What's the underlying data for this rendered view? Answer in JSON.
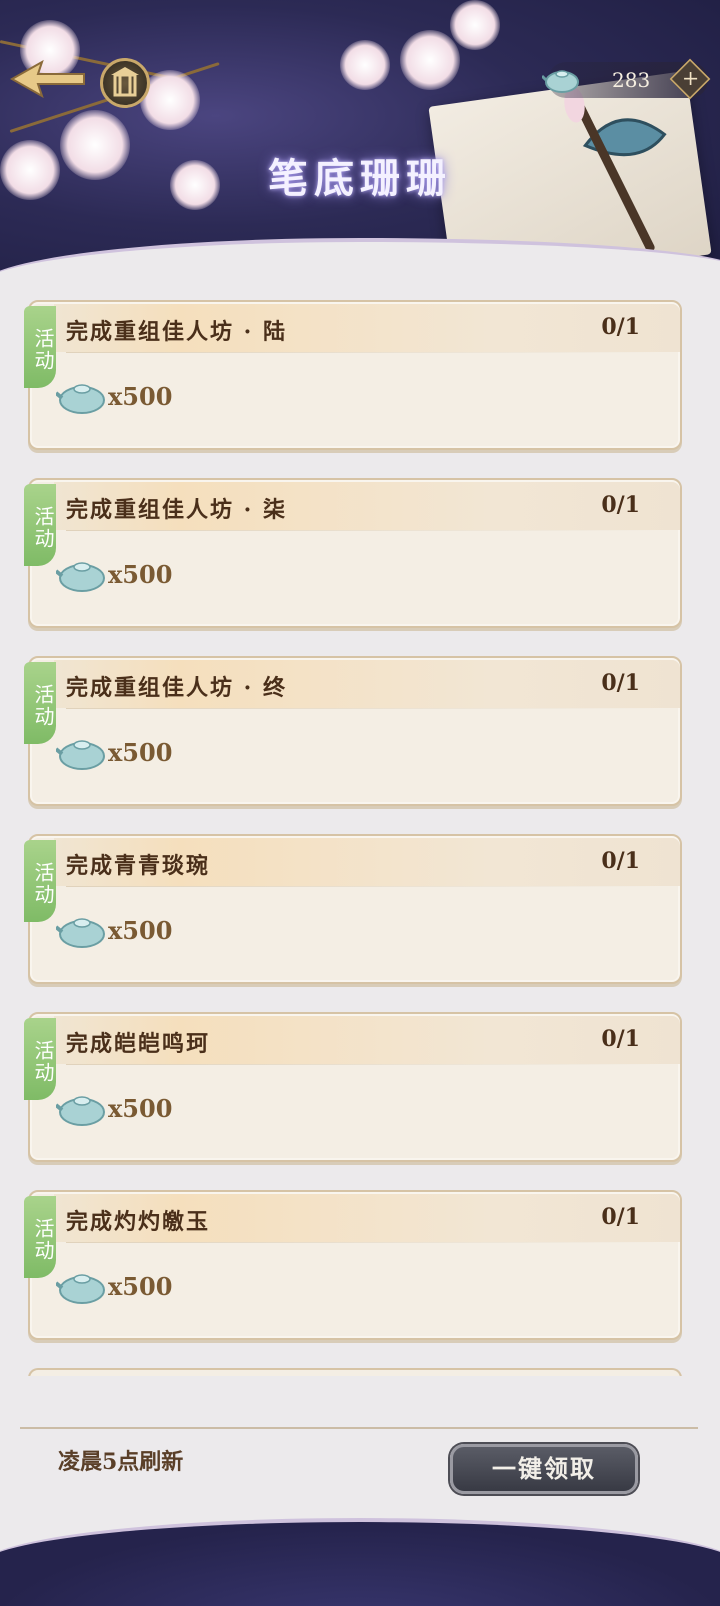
{
  "header": {
    "title": "笔底珊珊",
    "currency": {
      "icon": "jade-teapot-icon",
      "value": "283",
      "add_label": "+"
    }
  },
  "tasks": [
    {
      "tag": "活动",
      "title": "完成重组佳人坊 · 陆",
      "progress": "0/1",
      "reward_icon": "jade-teapot-icon",
      "reward_qty": "x500"
    },
    {
      "tag": "活动",
      "title": "完成重组佳人坊 · 柒",
      "progress": "0/1",
      "reward_icon": "jade-teapot-icon",
      "reward_qty": "x500"
    },
    {
      "tag": "活动",
      "title": "完成重组佳人坊 · 终",
      "progress": "0/1",
      "reward_icon": "jade-teapot-icon",
      "reward_qty": "x500"
    },
    {
      "tag": "活动",
      "title": "完成青青琰琬",
      "progress": "0/1",
      "reward_icon": "jade-teapot-icon",
      "reward_qty": "x500"
    },
    {
      "tag": "活动",
      "title": "完成皑皑鸣珂",
      "progress": "0/1",
      "reward_icon": "jade-teapot-icon",
      "reward_qty": "x500"
    },
    {
      "tag": "活动",
      "title": "完成灼灼皦玉",
      "progress": "0/1",
      "reward_icon": "jade-teapot-icon",
      "reward_qty": "x500"
    }
  ],
  "footer": {
    "refresh_text": "凌晨5点刷新",
    "claim_all_label": "一键领取"
  },
  "colors": {
    "header_bg": "#2c2a55",
    "card_bg": "#f4eee4",
    "tag_green": "#8cc472",
    "title_brown": "#4a2f1a"
  }
}
